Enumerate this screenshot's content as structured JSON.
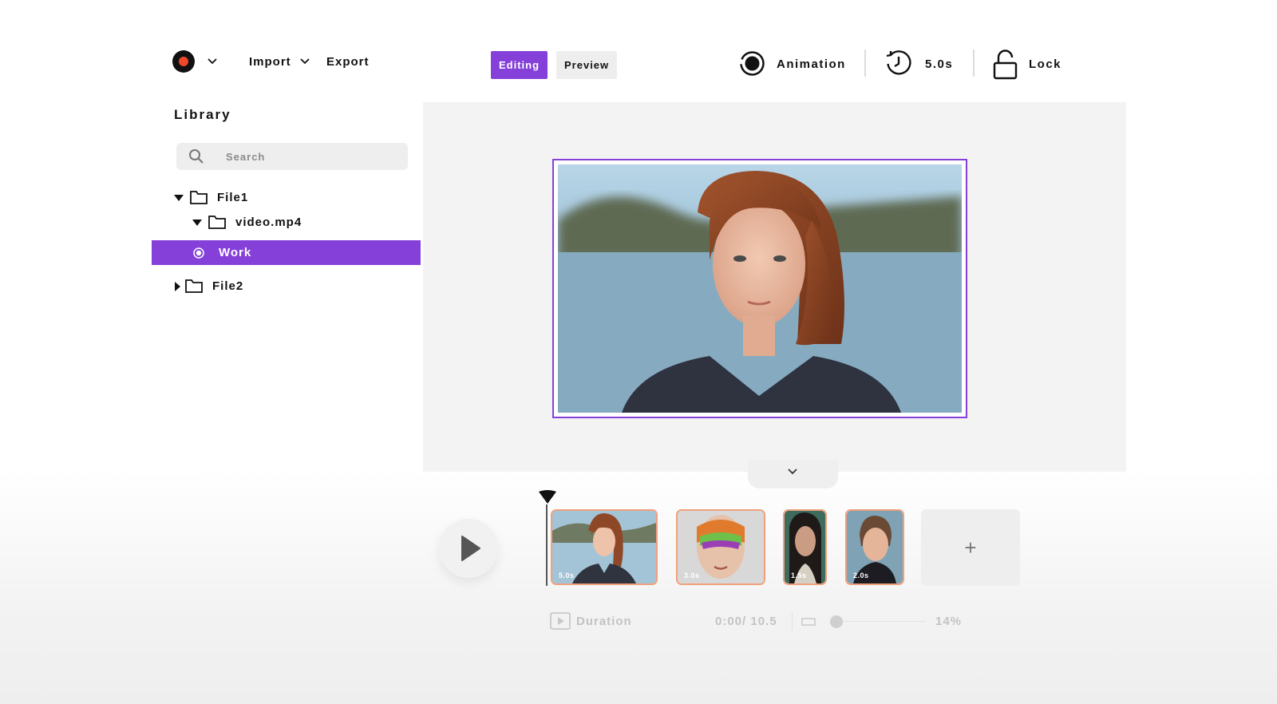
{
  "toolbar": {
    "import_label": "Import",
    "export_label": "Export",
    "tabs": [
      {
        "label": "Editing",
        "active": true
      },
      {
        "label": "Preview",
        "active": false
      }
    ],
    "animation_label": "Animation",
    "duration_label": "5.0s",
    "lock_label": "Lock",
    "record_color": "#f0462c"
  },
  "library": {
    "title": "Library",
    "search_placeholder": "Search",
    "tree": {
      "file1": "File1",
      "video": "video.mp4",
      "work": "Work",
      "file2": "File2"
    }
  },
  "accent_color": "#8540d9",
  "timeline": {
    "clips": [
      {
        "duration": "5.0s",
        "icon": "portrait-redhead-photo"
      },
      {
        "duration": "3.0s",
        "icon": "portrait-facepaint-photo"
      },
      {
        "duration": "1.5s",
        "icon": "portrait-dark-hair-photo"
      },
      {
        "duration": "2.0s",
        "icon": "portrait-short-hair-photo"
      }
    ],
    "add_label": "+"
  },
  "footer": {
    "duration_label": "Duration",
    "time": "0:00/ 10.5",
    "zoom": "14%"
  }
}
